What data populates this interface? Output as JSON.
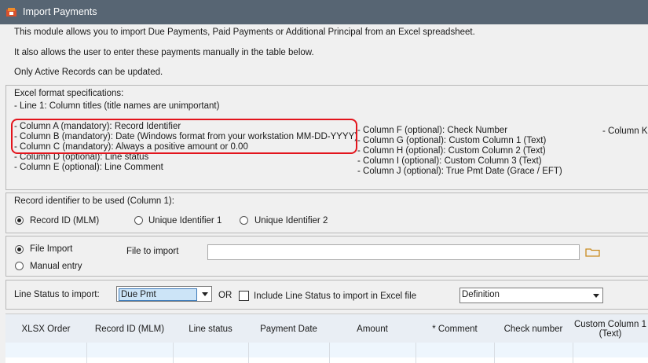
{
  "window": {
    "title": "Import Payments"
  },
  "intro": {
    "line1": "This module allows you to import Due Payments, Paid Payments or Additional Principal from an Excel spreadsheet.",
    "line2": "It also allows  the user to enter these payments manually in the table below.",
    "line3": "Only Active Records can be updated."
  },
  "spec": {
    "heading": "Excel format specifications:",
    "line1": "- Line 1: Column titles (title names are unimportant)",
    "col_a": "- Column A (mandatory): Record Identifier",
    "col_b": "- Column B (mandatory): Date (Windows format from your workstation MM-DD-YYYY)",
    "col_c": "- Column C (mandatory): Always a positive amount or 0.00",
    "col_d": "- Column D (optional): Line status",
    "col_e": "- Column E (optional): Line Comment",
    "col_f": "- Column F (optional): Check Number",
    "col_g": "- Column G (optional):  Custom Column 1 (Text)",
    "col_h": "- Column H (optional):  Custom Column 2 (Text)",
    "col_i": "- Column I (optional):  Custom Column 3 (Text)",
    "col_j": "- Column J (optional): True Pmt Date (Grace / EFT)",
    "col_k": "- Column K"
  },
  "record_identifier": {
    "label": "Record identifier to be used (Column 1):",
    "options": [
      "Record ID (MLM)",
      "Unique Identifier 1",
      "Unique Identifier 2"
    ],
    "selected": "Record ID (MLM)"
  },
  "import_mode": {
    "options": [
      "File Import",
      "Manual entry"
    ],
    "selected": "File Import",
    "file_label": "File to import",
    "file_value": ""
  },
  "line_status": {
    "label": "Line Status to import:",
    "selected": "Due Pmt",
    "or_label": "OR",
    "checkbox_label": "Include Line Status to import in Excel file",
    "checkbox_checked": false,
    "definition_value": "Definition"
  },
  "grid": {
    "columns": [
      "XLSX Order",
      "Record ID (MLM)",
      "Line status",
      "Payment Date",
      "Amount",
      "* Comment",
      "Check number",
      "Custom Column 1 (Text)"
    ]
  },
  "colors": {
    "titlebar": "#576573",
    "highlight_border": "#e3141c",
    "grid_header": "#e9eef4"
  },
  "icons": {
    "app": "app-icon",
    "folder": "folder-icon"
  }
}
